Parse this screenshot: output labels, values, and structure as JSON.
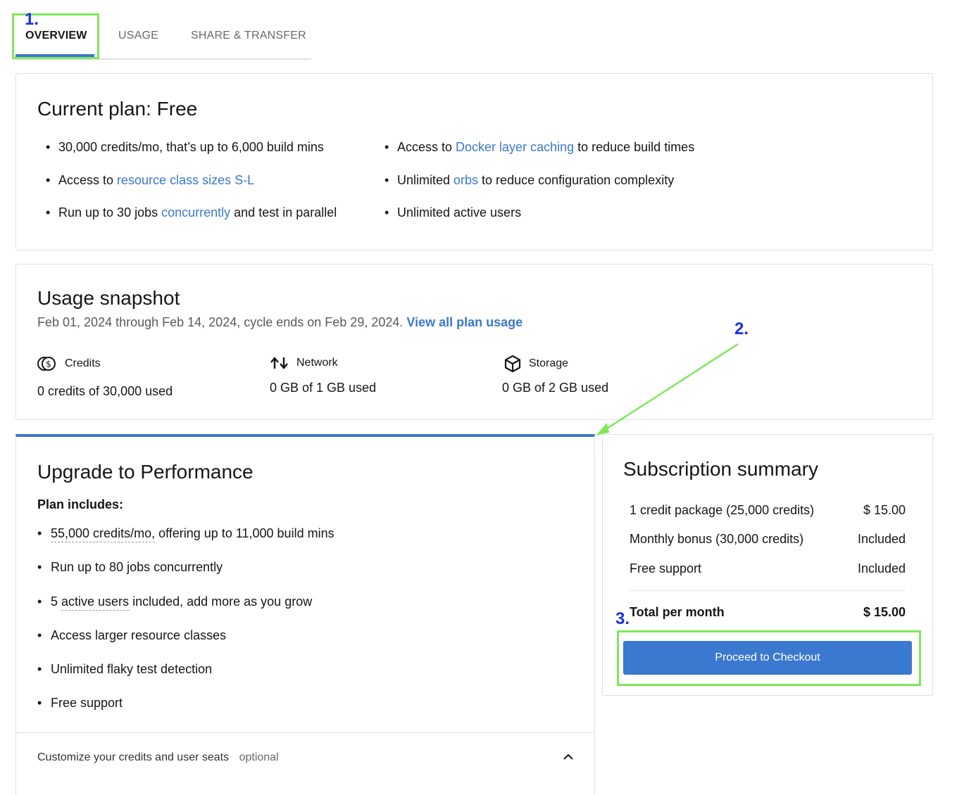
{
  "tabs": [
    {
      "label": "OVERVIEW",
      "active": true
    },
    {
      "label": "USAGE",
      "active": false
    },
    {
      "label": "SHARE & TRANSFER",
      "active": false
    }
  ],
  "annotations": [
    "1.",
    "2.",
    "3."
  ],
  "current_plan": {
    "title": "Current plan: Free",
    "left_items": [
      {
        "text_before": "30,000 credits/mo, that’s up to 6,000 build mins",
        "link": "",
        "text_after": ""
      },
      {
        "text_before": "Access to ",
        "link": "resource class sizes S-L",
        "text_after": ""
      },
      {
        "text_before": "Run up to 30 jobs ",
        "link": "concurrently",
        "text_after": " and test in parallel"
      }
    ],
    "right_items": [
      {
        "text_before": "Access to ",
        "link": "Docker layer caching",
        "text_after": " to reduce build times"
      },
      {
        "text_before": "Unlimited ",
        "link": "orbs",
        "text_after": " to reduce configuration complexity"
      },
      {
        "text_before": "Unlimited active users",
        "link": "",
        "text_after": ""
      }
    ]
  },
  "usage_snapshot": {
    "title": "Usage snapshot",
    "period": "Feb 01, 2024 through Feb 14, 2024, cycle ends on Feb 29, 2024.",
    "view_link": "View all plan usage",
    "metrics": [
      {
        "icon": "credits-icon",
        "label": "Credits",
        "value": "0 credits of 30,000 used"
      },
      {
        "icon": "network-icon",
        "label": "Network",
        "value": "0 GB of 1 GB used"
      },
      {
        "icon": "storage-icon",
        "label": "Storage",
        "value": "0 GB of 2 GB used"
      }
    ]
  },
  "upgrade": {
    "title": "Upgrade to Performance",
    "plan_includes": "Plan includes:",
    "items": [
      {
        "dotted": "55,000 credits/mo,",
        "rest": " offering up to 11,000 build mins",
        "prefix": ""
      },
      {
        "dotted": "",
        "rest": "Run up to 80 jobs concurrently",
        "prefix": ""
      },
      {
        "prefix": "5 ",
        "dotted": "active users",
        "rest": " included, add more as you grow"
      },
      {
        "dotted": "",
        "rest": "Access larger resource classes",
        "prefix": ""
      },
      {
        "dotted": "",
        "rest": "Unlimited flaky test detection",
        "prefix": ""
      },
      {
        "dotted": "",
        "rest": "Free support",
        "prefix": ""
      }
    ],
    "customize_label": "Customize your credits and user seats",
    "customize_optional": "optional"
  },
  "summary": {
    "title": "Subscription summary",
    "rows": [
      {
        "label": "1 credit package (25,000 credits)",
        "value": "$ 15.00"
      },
      {
        "label": "Monthly bonus (30,000 credits)",
        "value": "Included"
      },
      {
        "label": "Free support",
        "value": "Included"
      }
    ],
    "total_label": "Total per month",
    "total_value": "$ 15.00",
    "checkout_button": "Proceed to Checkout"
  },
  "colors": {
    "accent": "#3b78cf",
    "annotation_green": "#7ee85a",
    "annotation_blue": "#1c2fe8"
  }
}
